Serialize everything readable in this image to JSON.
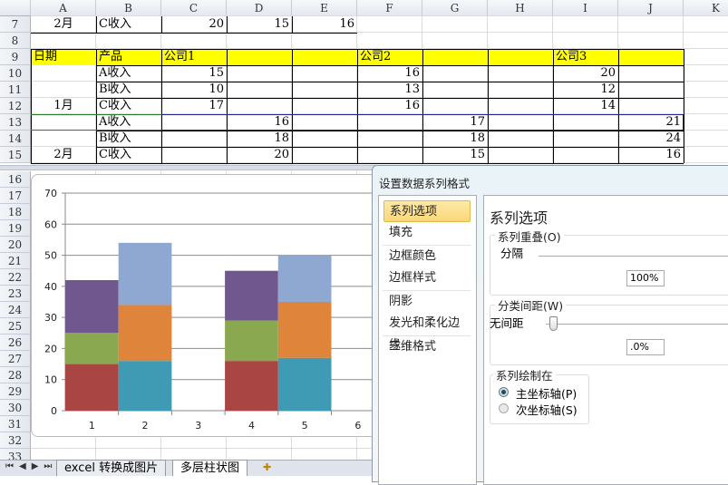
{
  "columns": [
    "A",
    "B",
    "C",
    "D",
    "E",
    "F",
    "G",
    "H",
    "I",
    "J",
    "K"
  ],
  "rows_top": [
    "7",
    "8",
    "9",
    "10",
    "11",
    "12",
    "13",
    "14",
    "15"
  ],
  "rows_bottom": [
    "16",
    "17",
    "18",
    "19",
    "20",
    "21",
    "22",
    "23",
    "24",
    "25",
    "26",
    "27",
    "28",
    "29",
    "30",
    "31",
    "32",
    "33"
  ],
  "row7": {
    "a": "2月",
    "b": "C收入",
    "c": "20",
    "d": "15",
    "e": "16"
  },
  "table": {
    "header": {
      "date": "日期",
      "product": "产品",
      "company1": "公司1",
      "company2": "公司2",
      "company3": "公司3"
    },
    "month1": "1月",
    "month2": "2月",
    "rows": [
      {
        "product": "A收入",
        "c1": "15",
        "c2": "16",
        "c3": "20"
      },
      {
        "product": "B收入",
        "c1": "10",
        "c2": "13",
        "c3": "12"
      },
      {
        "product": "C收入",
        "c1": "17",
        "c2": "16",
        "c3": "14"
      },
      {
        "product": "A收入",
        "c1": "16",
        "c2": "17",
        "c3": "21"
      },
      {
        "product": "B收入",
        "c1": "18",
        "c2": "18",
        "c3": "24"
      },
      {
        "product": "C收入",
        "c1": "20",
        "c2": "15",
        "c3": "16"
      }
    ],
    "header_color": "#ffff00"
  },
  "chart_data": {
    "type": "bar",
    "stacked": true,
    "categories": [
      "1",
      "2",
      "3",
      "4",
      "5",
      "6"
    ],
    "series": [
      {
        "values": [
          15,
          16,
          null,
          16,
          17,
          null
        ],
        "colors": [
          "#a94543",
          "#3f9bb3",
          "",
          "#a94543",
          "#3f9bb3",
          ""
        ]
      },
      {
        "values": [
          10,
          18,
          null,
          13,
          18,
          null
        ],
        "colors": [
          "#8aa84f",
          "#de843b",
          "",
          "#8aa84f",
          "#de843b",
          ""
        ]
      },
      {
        "values": [
          17,
          20,
          null,
          16,
          15,
          null
        ],
        "colors": [
          "#70588f",
          "#8fa8d2",
          "",
          "#70588f",
          "#8fa8d2",
          ""
        ]
      }
    ],
    "ylim": [
      0,
      70
    ],
    "yticks": [
      "0",
      "10",
      "20",
      "30",
      "40",
      "50",
      "60",
      "70"
    ],
    "grid": true
  },
  "dialog": {
    "title": "设置数据系列格式",
    "nav": [
      "系列选项",
      "填充",
      "边框颜色",
      "边框样式",
      "阴影",
      "发光和柔化边缘",
      "三维格式"
    ],
    "selected_nav": "系列选项",
    "heading": "系列选项",
    "overlap": {
      "label": "系列重叠(O)",
      "left": "分隔",
      "value": "100%"
    },
    "gap": {
      "label": "分类间距(W)",
      "left": "无间距",
      "value": ".0%",
      "slider": 0
    },
    "plot_on": {
      "label": "系列绘制在",
      "primary": "主坐标轴(P)",
      "secondary": "次坐标轴(S)",
      "selected": "primary"
    }
  },
  "sheets": {
    "tabs": [
      "excel 转换成图片",
      "多层柱状图"
    ],
    "active": "多层柱状图"
  }
}
